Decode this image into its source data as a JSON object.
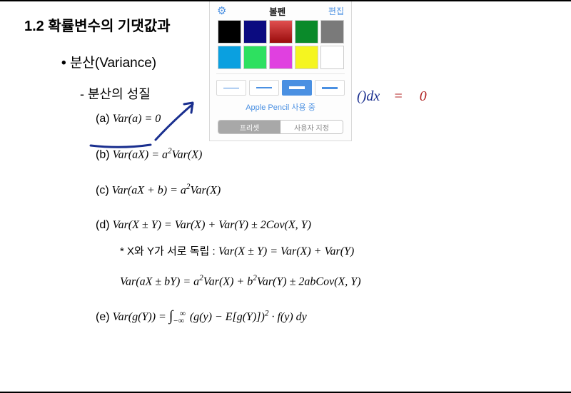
{
  "section_title": "1.2 확률변수의 기댓값과 ",
  "bullet_label": "분산(Variance)",
  "sub_label": "- 분산의 성질",
  "items": {
    "a": {
      "label": "(a)",
      "formula": "Var(a) = 0"
    },
    "b": {
      "label": "(b)",
      "formula": "Var(aX) = a²Var(X)"
    },
    "c": {
      "label": "(c)",
      "formula": "Var(aX + b) = a²Var(X)"
    },
    "d": {
      "label": "(d)",
      "formula": "Var(X ± Y) = Var(X) + Var(Y) ± 2Cov(X, Y)",
      "note_prefix": "* X와 Y가 서로 독립 :  ",
      "note_formula": "Var(X ± Y) = Var(X) + Var(Y)",
      "extra": "Var(aX ± bY) = a²Var(X) + b²Var(Y) ± 2abCov(X, Y)"
    },
    "e": {
      "label": "(e)",
      "formula": "Var(g(Y)) = ∫₋∞^∞ (g(y) − E[g(Y)])² · f(y) dy"
    }
  },
  "handwriting": {
    "part1": "()dx",
    "part2": "=",
    "part3": "0"
  },
  "pen_panel": {
    "title": "볼펜",
    "edit": "편집",
    "gear_icon": "⚙",
    "colors_row1": [
      "#000000",
      "#0b0b80",
      "#b01818",
      "#0a8a2a",
      "#7a7a7a"
    ],
    "colors_row2": [
      "#0aa0e0",
      "#2ee060",
      "#e040e0",
      "#f5f520",
      "#ffffff"
    ],
    "strokes": [
      1,
      2,
      4,
      3
    ],
    "selected_stroke_index": 2,
    "pencil_note": "Apple Pencil 사용 중",
    "segments": [
      "프리셋",
      "사용자 지정"
    ],
    "active_segment_index": 0
  }
}
